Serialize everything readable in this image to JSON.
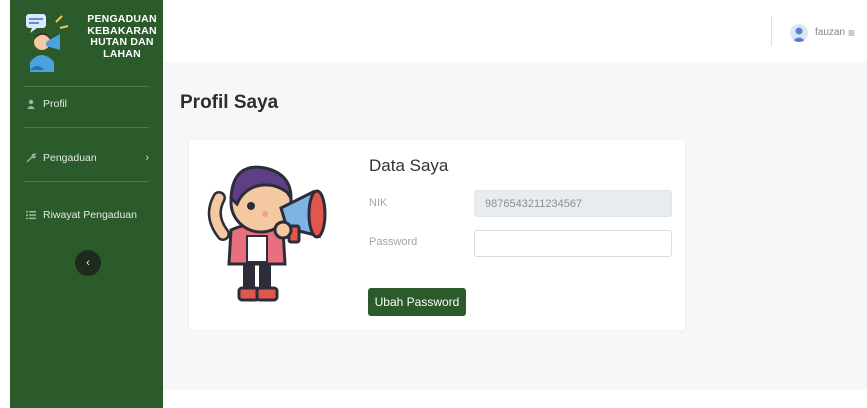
{
  "sidebar": {
    "brand": {
      "line1": "PENGADUAN",
      "line2": "KEBAKARAN",
      "line3": "HUTAN DAN",
      "line4": "LAHAN"
    },
    "items": [
      {
        "label": "Profil",
        "icon": "user-icon"
      },
      {
        "label": "Pengaduan",
        "icon": "wrench-icon",
        "has_submenu": true
      },
      {
        "label": "Riwayat Pengaduan",
        "icon": "list-icon"
      }
    ],
    "collapse_icon": "chevron-left-icon"
  },
  "topbar": {
    "username": "fauzan",
    "menu_icon": "hamburger-icon"
  },
  "page": {
    "title": "Profil Saya"
  },
  "card": {
    "title": "Data Saya",
    "nik_label": "NIK",
    "nik_value": "9876543211234567",
    "password_label": "Password",
    "password_value": "",
    "button_label": "Ubah Password"
  },
  "colors": {
    "sidebar": "#2b5a2b",
    "content_bg": "#f6f7f8",
    "button": "#2b5a2b"
  }
}
